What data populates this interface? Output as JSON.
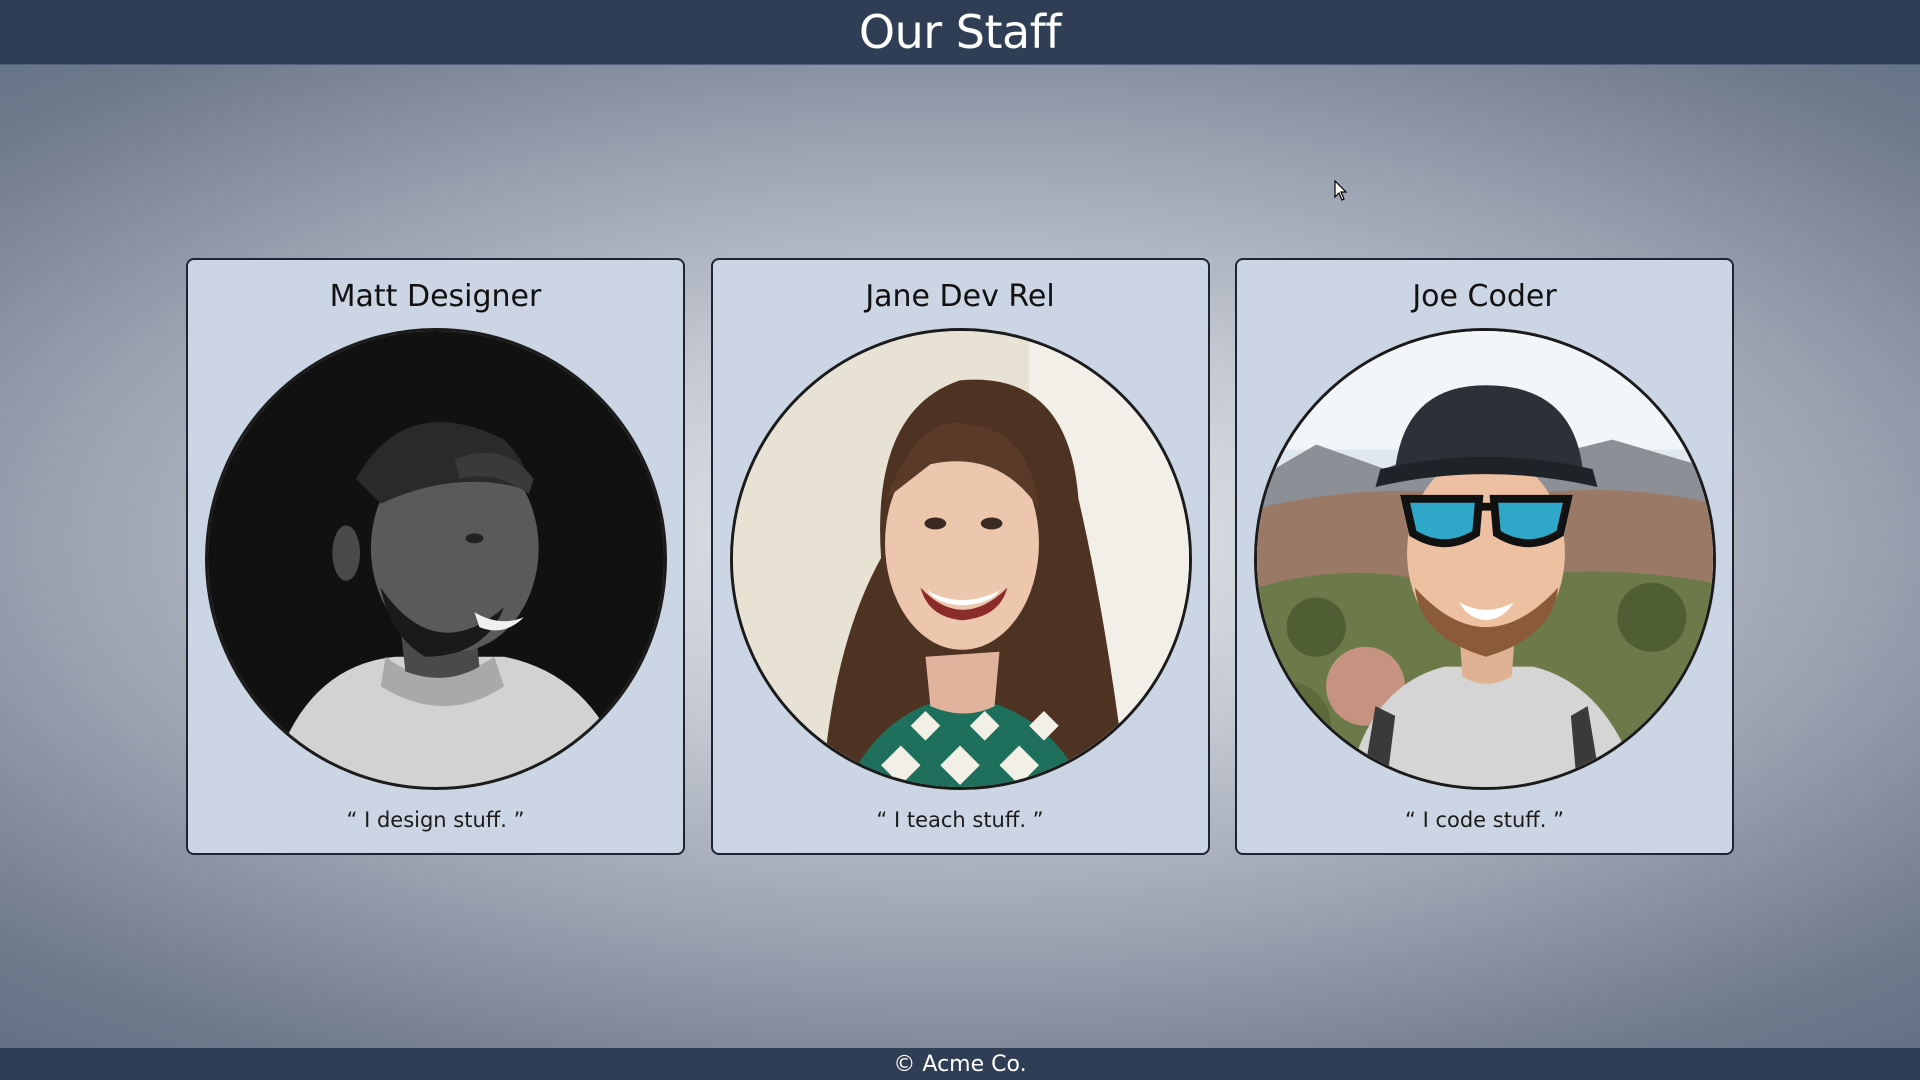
{
  "header": {
    "title": "Our Staff"
  },
  "staff": [
    {
      "name": "Matt Designer",
      "quote": "“ I design stuff. ”",
      "photo_icon": "matt-portrait-photo"
    },
    {
      "name": "Jane Dev Rel",
      "quote": "“ I teach stuff. ”",
      "photo_icon": "jane-portrait-photo"
    },
    {
      "name": "Joe Coder",
      "quote": "“ I code stuff. ”",
      "photo_icon": "joe-portrait-photo"
    }
  ],
  "footer": {
    "text": "© Acme Co."
  },
  "colors": {
    "header_bg": "#2f3e55",
    "card_bg": "#cbd5e3",
    "card_border": "#1e2530"
  }
}
